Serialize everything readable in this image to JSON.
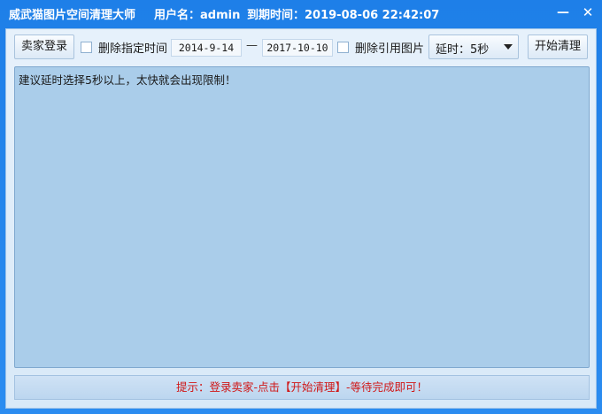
{
  "titlebar": {
    "app_name": "威武猫图片空间清理大师",
    "user": "用户名：admin",
    "expiry": "到期时间：2019-08-06 22:42:07",
    "minimize": "—",
    "close": "✕"
  },
  "toolbar": {
    "login_label": "卖家登录",
    "delete_by_time_label": "删除指定时间",
    "delete_by_time_checked": false,
    "start_date": "2014-9-14",
    "range_separator": "—",
    "end_date": "2017-10-10",
    "delete_referenced_label": "删除引用图片",
    "delete_referenced_checked": false,
    "delay_value": "延时：5秒",
    "start_label": "开始清理"
  },
  "log": {
    "text": "建议延时选择5秒以上，太快就会出现限制！"
  },
  "status": {
    "hint": "提示：登录卖家-点击【开始清理】-等待完成即可！"
  },
  "colors": {
    "title_bg": "#1e7fe8",
    "log_bg": "#aacdea",
    "hint_text": "#d01818"
  }
}
